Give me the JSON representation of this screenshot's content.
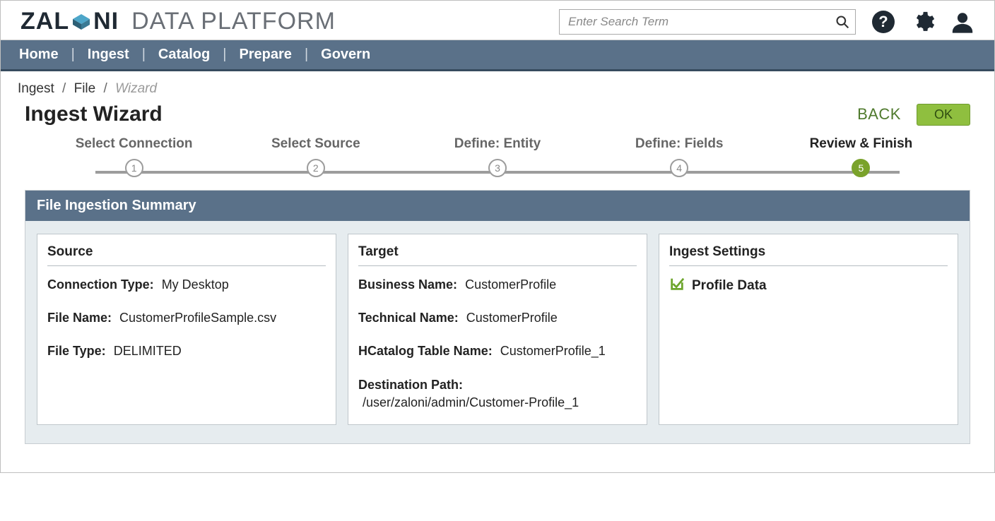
{
  "brand": {
    "strong": "ZAL",
    "strong2": "NI",
    "light": "DATA PLATFORM"
  },
  "search": {
    "placeholder": "Enter Search Term"
  },
  "nav": {
    "home": "Home",
    "ingest": "Ingest",
    "catalog": "Catalog",
    "prepare": "Prepare",
    "govern": "Govern"
  },
  "breadcrumb": {
    "a": "Ingest",
    "b": "File",
    "c": "Wizard"
  },
  "page_title": "Ingest Wizard",
  "buttons": {
    "back": "BACK",
    "ok": "OK"
  },
  "steps": {
    "s1": {
      "label": "Select Connection",
      "num": "1"
    },
    "s2": {
      "label": "Select Source",
      "num": "2"
    },
    "s3": {
      "label": "Define: Entity",
      "num": "3"
    },
    "s4": {
      "label": "Define: Fields",
      "num": "4"
    },
    "s5": {
      "label": "Review & Finish",
      "num": "5"
    }
  },
  "panel": {
    "header": "File Ingestion Summary"
  },
  "source": {
    "title": "Source",
    "conn_type_k": "Connection Type:",
    "conn_type_v": "My Desktop",
    "file_name_k": "File Name:",
    "file_name_v": "CustomerProfileSample.csv",
    "file_type_k": "File Type:",
    "file_type_v": "DELIMITED"
  },
  "target": {
    "title": "Target",
    "bname_k": "Business Name:",
    "bname_v": "CustomerProfile",
    "tname_k": "Technical Name:",
    "tname_v": "CustomerProfile",
    "hcat_k": "HCatalog Table Name:",
    "hcat_v": "CustomerProfile_1",
    "dest_k": "Destination Path:",
    "dest_v": "/user/zaloni/admin/Customer-Profile_1"
  },
  "settings": {
    "title": "Ingest Settings",
    "profile_data": "Profile Data"
  }
}
